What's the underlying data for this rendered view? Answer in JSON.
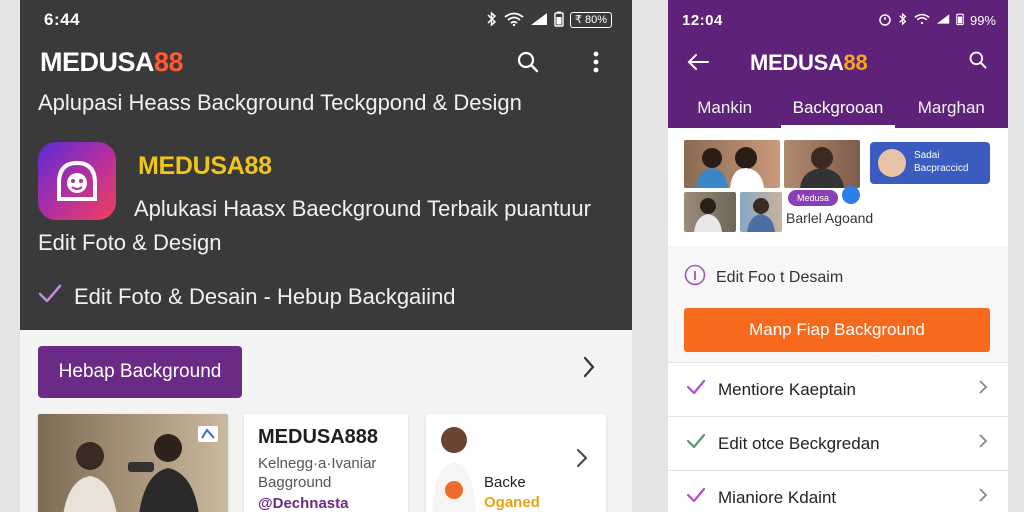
{
  "left": {
    "status": {
      "time": "6:44",
      "battery": "₹ 80%"
    },
    "brand": {
      "part1": "MEDUSA",
      "part2": "88"
    },
    "subtitle": "Aplupasi Heass Background Teckgpond & Design",
    "app": {
      "name": "MEDUSA88",
      "description": "Aplukasi Haasx Baeckground Terbaik puantuur",
      "description2": "Edit Foto & Design"
    },
    "feature": "Edit Foto  & Desain - Hebup Backgaiind",
    "primary_button": "Hebap Background",
    "card2": {
      "title": "MEDUSA888",
      "line1": "Kelnegg·a·Ivaniar",
      "line2": "Bagground",
      "tag": "@Dechnasta"
    },
    "card3": {
      "label": "Backe",
      "tag": "Oganed"
    }
  },
  "right": {
    "status": {
      "time": "12:04",
      "battery": "99%"
    },
    "brand": {
      "part1": "MEDUSA",
      "part2": "88"
    },
    "tabs": [
      {
        "label": "Mankin"
      },
      {
        "label": "Backgrooan",
        "active": true
      },
      {
        "label": "Marghan"
      }
    ],
    "promo": {
      "line1": "Sadai",
      "line2": "Bacpraccicd"
    },
    "gallery": {
      "badge": "Medusa",
      "caption": "Barlel Agoand"
    },
    "edit_label": "Edit Foo t Desaim",
    "cta_button": "Manp Fiap Background",
    "list": [
      {
        "label": "Mentiore Kaeptain"
      },
      {
        "label": "Edit otce Beckgredan"
      },
      {
        "label": "Mianiore Kdaint"
      }
    ]
  },
  "colors": {
    "left_header": "#3a3a3a",
    "right_header": "#5e2279",
    "accent_purple": "#6b2a86",
    "accent_orange": "#f76a1e",
    "brand_red": "#ff5a36",
    "brand_gold": "#f0c419"
  },
  "icons": [
    "search-icon",
    "more-vert-icon",
    "back-arrow-icon",
    "check-icon",
    "chevron-right-icon",
    "bluetooth-icon",
    "wifi-icon",
    "signal-icon",
    "battery-icon",
    "alarm-icon",
    "info-circle-icon"
  ]
}
